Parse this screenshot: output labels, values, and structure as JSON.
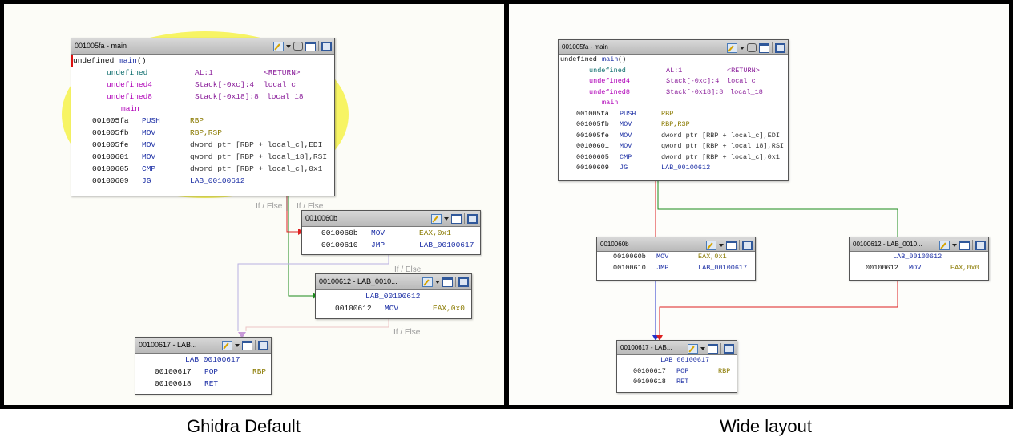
{
  "captions": {
    "left": "Ghidra Default",
    "right": "Wide layout"
  },
  "edge_labels": {
    "if_else": "If / Else"
  },
  "listing": {
    "func_sig": {
      "ret": "undefined",
      "name": "main",
      "parens": "()"
    },
    "params": [
      {
        "type": "undefined",
        "storage": "AL:1",
        "name": "<RETURN>"
      },
      {
        "type": "undefined4",
        "storage": "Stack[-0xc]:4",
        "name": "local_c"
      },
      {
        "type": "undefined8",
        "storage": "Stack[-0x18]:8",
        "name": "local_18"
      }
    ],
    "label": "main",
    "instructions": [
      {
        "addr": "001005fa",
        "mn": "PUSH",
        "ops": "RBP"
      },
      {
        "addr": "001005fb",
        "mn": "MOV",
        "ops": "RBP,RSP"
      },
      {
        "addr": "001005fe",
        "mn": "MOV",
        "ops": "dword ptr [RBP + local_c],EDI"
      },
      {
        "addr": "00100601",
        "mn": "MOV",
        "ops": "qword ptr [RBP + local_18],RSI"
      },
      {
        "addr": "00100605",
        "mn": "CMP",
        "ops": "dword ptr [RBP + local_c],0x1"
      },
      {
        "addr": "00100609",
        "mn": "JG",
        "ops": "LAB_00100612"
      }
    ]
  },
  "blocks": {
    "main": {
      "title": "001005fa - main"
    },
    "b060b": {
      "title": "0010060b",
      "instructions": [
        {
          "addr": "0010060b",
          "mn": "MOV",
          "ops": "EAX,0x1"
        },
        {
          "addr": "00100610",
          "mn": "JMP",
          "ops": "LAB_00100617"
        }
      ]
    },
    "b0612": {
      "title_left": "00100612 - LAB_0010...",
      "title_right": "00100612 - LAB_0010...",
      "label": "LAB_00100612",
      "instructions": [
        {
          "addr": "00100612",
          "mn": "MOV",
          "ops": "EAX,0x0"
        }
      ]
    },
    "b0617": {
      "title_left": "00100617 - LAB...",
      "title_right": "00100617 - LAB...",
      "label": "LAB_00100617",
      "instructions": [
        {
          "addr": "00100617",
          "mn": "POP",
          "ops": "RBP"
        },
        {
          "addr": "00100618",
          "mn": "RET",
          "ops": ""
        }
      ]
    }
  },
  "colors": {
    "edge_true": "#1a8a1a",
    "edge_false": "#dd2020",
    "edge_uncond": "#2233cc",
    "edge_faded_purple": "#b9b0e0",
    "edge_faded_pink": "#ecc4c4",
    "highlight": "#f6f24a"
  }
}
